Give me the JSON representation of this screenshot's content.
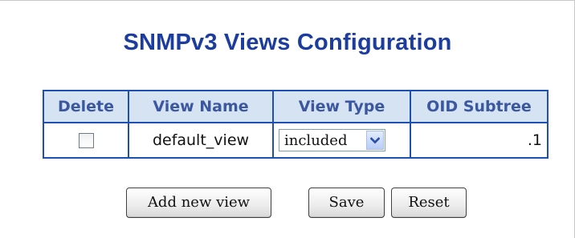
{
  "page": {
    "title": "SNMPv3 Views Configuration"
  },
  "table": {
    "headers": [
      "Delete",
      "View Name",
      "View Type",
      "OID Subtree"
    ],
    "rows": [
      {
        "delete_checked": false,
        "view_name": "default_view",
        "view_type": "included",
        "oid_subtree": ".1"
      }
    ]
  },
  "buttons": {
    "add_new_view": "Add new view",
    "save": "Save",
    "reset": "Reset"
  },
  "icons": {
    "select_arrow": "chevron-down-icon"
  },
  "colors": {
    "title": "#1c3d9e",
    "header_bg": "#d6e3f3",
    "header_text": "#3a57a0",
    "table_border": "#1e4fb3"
  }
}
